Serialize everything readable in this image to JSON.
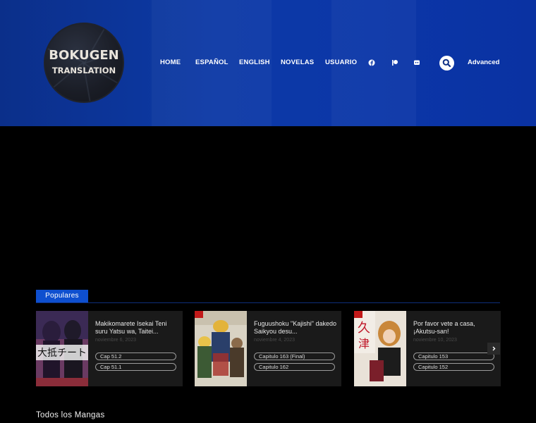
{
  "site": {
    "logo_line1": "BOKUGEN",
    "logo_line2": "TRANSLATION"
  },
  "nav": {
    "items": [
      "HOME",
      "ESPAÑOL",
      "ENGLISH",
      "NOVELAS",
      "USUARIO"
    ],
    "icons": [
      "facebook-icon",
      "patreon-icon",
      "discord-icon"
    ],
    "search_icon": "search-icon",
    "advanced_label": "Advanced"
  },
  "popular": {
    "tab_label": "Populares",
    "cards": [
      {
        "title": "Makikomarete Isekai Teni suru Yatsu wa, Taitei...",
        "date": "noviembre 6, 2023",
        "chapters": [
          "Cap 51.2",
          "Cap 51.1"
        ]
      },
      {
        "title": "Fuguushoku \"Kajishi\" dakedo Saikyou desu...",
        "date": "noviembre 4, 2023",
        "chapters": [
          "Capitulo 163 (Final)",
          "Capitulo 162"
        ]
      },
      {
        "title": "Por favor vete a casa, ¡Akutsu-san!",
        "date": "noviembre 10, 2023",
        "chapters": [
          "Capitulo 153",
          "Capitulo 152"
        ]
      }
    ],
    "next_icon": "chevron-right-icon"
  },
  "all_mangas_title": "Todos los Mangas",
  "colors": {
    "header_blue": "#0d3aa6",
    "accent_blue": "#0e4fcf",
    "background": "#000000",
    "card_bg": "#1a1a1a"
  }
}
